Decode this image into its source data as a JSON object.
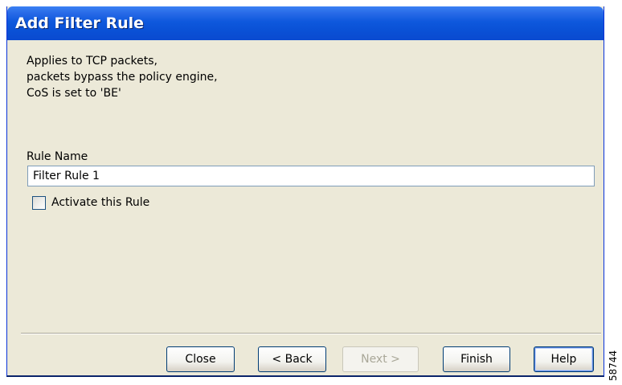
{
  "window": {
    "title": "Add Filter Rule"
  },
  "description": {
    "lines": [
      "Applies to TCP packets,",
      "packets bypass the policy engine,",
      "CoS is set to 'BE'"
    ]
  },
  "rule_name": {
    "label": "Rule Name",
    "value": "Filter Rule 1"
  },
  "activate": {
    "label": "Activate this Rule",
    "checked": false
  },
  "buttons": {
    "close": "Close",
    "back": "< Back",
    "next": "Next >",
    "finish": "Finish",
    "help": "Help"
  },
  "figure_number": "58744"
}
